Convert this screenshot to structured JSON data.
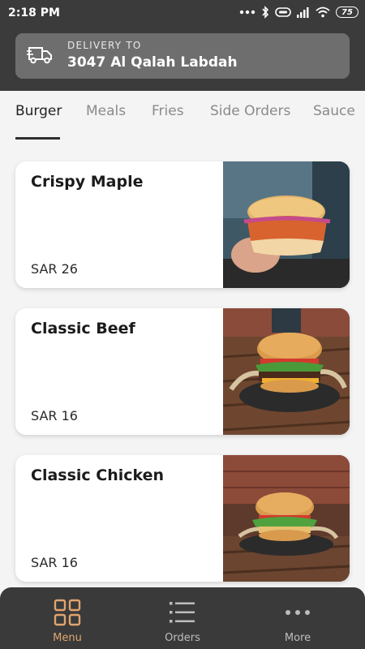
{
  "status_bar": {
    "time": "2:18 PM",
    "battery": "75"
  },
  "header": {
    "delivery_label": "DELIVERY TO",
    "address": "3047 Al Qalah Labdah"
  },
  "tabs": [
    {
      "label": "Burger",
      "active": true
    },
    {
      "label": "Meals"
    },
    {
      "label": "Fries"
    },
    {
      "label": "Side Orders"
    },
    {
      "label": "Sauce"
    }
  ],
  "items": [
    {
      "name": "Crispy Maple",
      "price": "SAR 26"
    },
    {
      "name": "Classic Beef",
      "price": "SAR 16"
    },
    {
      "name": "Classic Chicken",
      "price": "SAR 16"
    }
  ],
  "bottom_nav": [
    {
      "label": "Menu",
      "icon": "grid-icon",
      "active": true
    },
    {
      "label": "Orders",
      "icon": "list-icon"
    },
    {
      "label": "More",
      "icon": "more-icon"
    }
  ],
  "colors": {
    "header_bg": "#3b3b3b",
    "accent": "#e0a46e",
    "page_bg": "#f4f4f4"
  }
}
